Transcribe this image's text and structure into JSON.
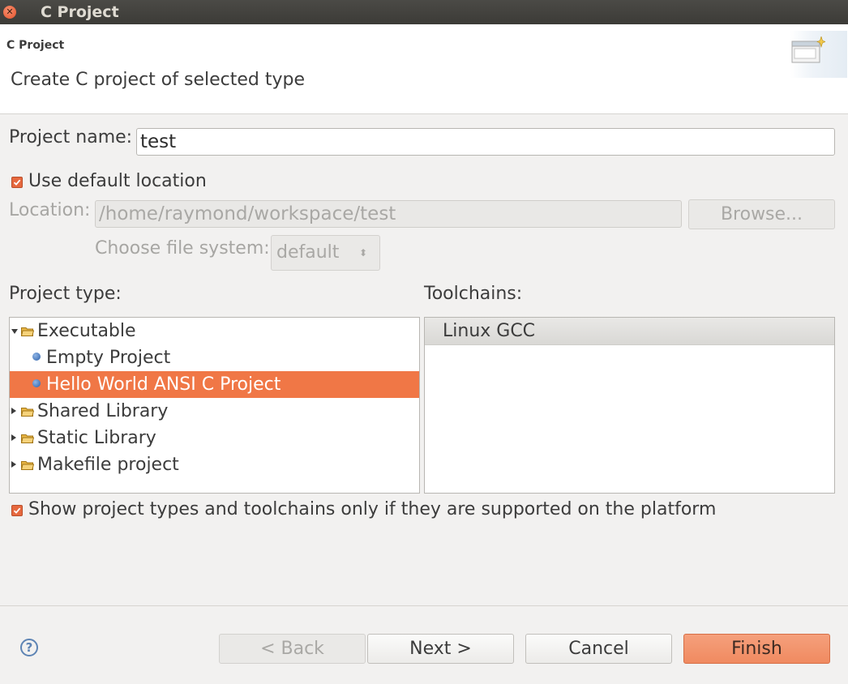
{
  "window": {
    "title": "C Project",
    "close_icon": "close-icon"
  },
  "header": {
    "title": "C Project",
    "description": "Create C project of selected type",
    "icon": "new-project-wizard-icon"
  },
  "form": {
    "project_name_label": "Project name:",
    "project_name_value": "test",
    "use_default_location": {
      "label": "Use default location",
      "checked": true
    },
    "location_label": "Location:",
    "location_value": "/home/raymond/workspace/test",
    "browse_label": "Browse...",
    "file_system_label": "Choose file system:",
    "file_system_value": "default"
  },
  "project_type": {
    "label": "Project type:",
    "items": [
      {
        "label": "Executable",
        "kind": "folder",
        "expanded": true
      },
      {
        "label": "Empty Project",
        "kind": "leaf"
      },
      {
        "label": "Hello World ANSI C Project",
        "kind": "leaf",
        "selected": true
      },
      {
        "label": "Shared Library",
        "kind": "folder",
        "expanded": false
      },
      {
        "label": "Static Library",
        "kind": "folder",
        "expanded": false
      },
      {
        "label": "Makefile project",
        "kind": "folder",
        "expanded": false
      }
    ]
  },
  "toolchains": {
    "label": "Toolchains:",
    "items": [
      {
        "label": "Linux GCC",
        "selected": true
      }
    ]
  },
  "show_supported": {
    "label": "Show project types and toolchains only if they are supported on the platform",
    "checked": true
  },
  "buttons": {
    "back": "< Back",
    "next": "Next >",
    "cancel": "Cancel",
    "finish": "Finish"
  },
  "colors": {
    "accent": "#f07746",
    "titlebar": "#3c3b37",
    "background": "#f2f1f0"
  }
}
